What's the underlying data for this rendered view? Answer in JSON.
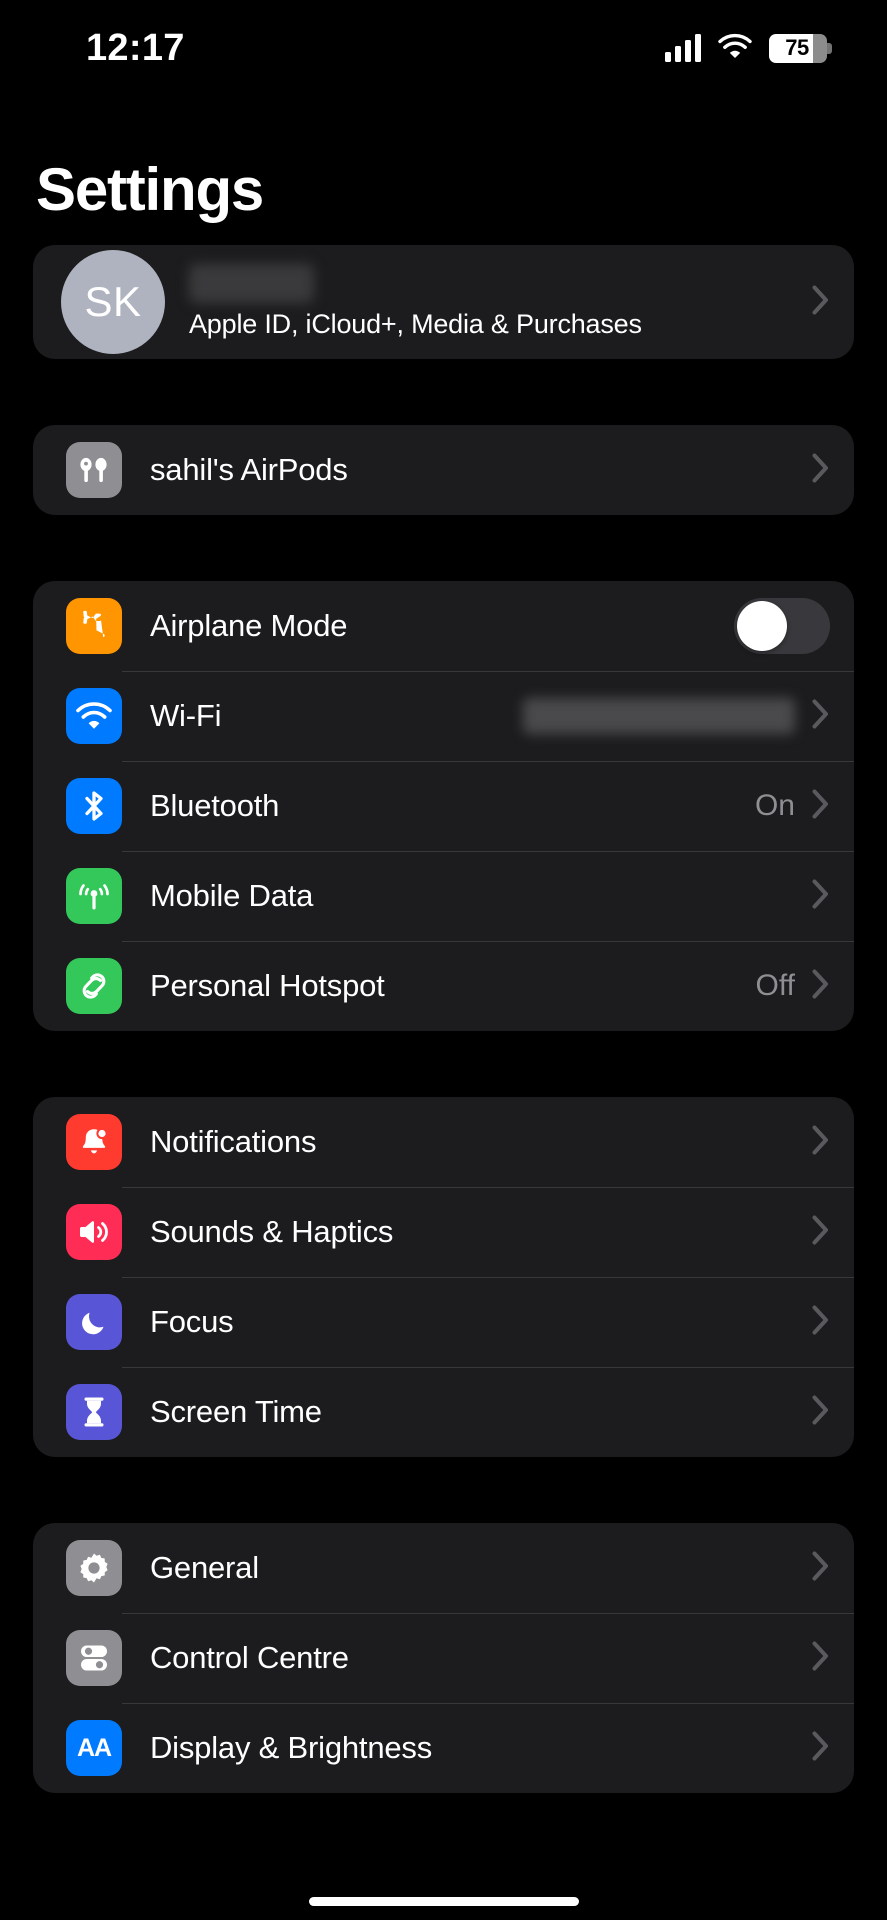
{
  "status_bar": {
    "time": "12:17",
    "battery_percent": "75",
    "signal_icon": "cellular-bars-icon",
    "wifi_icon": "wifi-icon",
    "battery_icon": "battery-icon"
  },
  "header": {
    "title": "Settings"
  },
  "account": {
    "initials": "SK",
    "name": "",
    "subtitle": "Apple ID, iCloud+, Media & Purchases",
    "chevron": "chevron-right-icon"
  },
  "devices": {
    "rows": [
      {
        "label": "sahil's AirPods",
        "value": "",
        "icon": "airpods-icon",
        "icon_color": "#8E8E93"
      }
    ]
  },
  "connectivity": {
    "rows": [
      {
        "label": "Airplane Mode",
        "value": "",
        "icon": "airplane-icon",
        "icon_color": "#FF9500",
        "control": "toggle",
        "toggle_on": false
      },
      {
        "label": "Wi-Fi",
        "value": "SSID_REDACTED",
        "icon": "wifi-icon",
        "icon_color": "#007AFF",
        "control": "value-blurred"
      },
      {
        "label": "Bluetooth",
        "value": "On",
        "icon": "bluetooth-icon",
        "icon_color": "#007AFF",
        "control": "value"
      },
      {
        "label": "Mobile Data",
        "value": "",
        "icon": "cellular-tower-icon",
        "icon_color": "#34C759",
        "control": "value"
      },
      {
        "label": "Personal Hotspot",
        "value": "Off",
        "icon": "hotspot-icon",
        "icon_color": "#34C759",
        "control": "value"
      }
    ]
  },
  "alerts": {
    "rows": [
      {
        "label": "Notifications",
        "value": "",
        "icon": "bell-icon",
        "icon_color": "#FF3B30"
      },
      {
        "label": "Sounds & Haptics",
        "value": "",
        "icon": "speaker-icon",
        "icon_color": "#FF2D55"
      },
      {
        "label": "Focus",
        "value": "",
        "icon": "moon-icon",
        "icon_color": "#5856D6"
      },
      {
        "label": "Screen Time",
        "value": "",
        "icon": "hourglass-icon",
        "icon_color": "#5856D6"
      }
    ]
  },
  "system": {
    "rows": [
      {
        "label": "General",
        "value": "",
        "icon": "gear-icon",
        "icon_color": "#8E8E93"
      },
      {
        "label": "Control Centre",
        "value": "",
        "icon": "sliders-icon",
        "icon_color": "#8E8E93"
      },
      {
        "label": "Display & Brightness",
        "value": "",
        "icon": "text-size-aa-icon",
        "icon_color": "#007AFF"
      }
    ]
  },
  "colors": {
    "background": "#000000",
    "card": "#1C1C1E",
    "separator": "#38383A",
    "secondary_text": "#8E8E93",
    "accent_blue": "#007AFF"
  }
}
